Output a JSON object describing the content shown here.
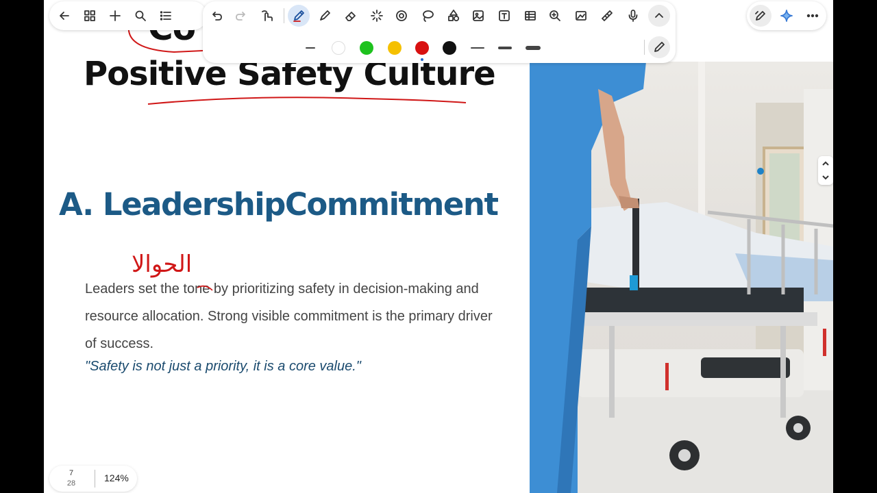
{
  "slide": {
    "title_top": "Co",
    "title": "Positive Safety Culture",
    "section_heading": "A. LeadershipCommitment",
    "body": "Leaders set the tone by prioritizing safety in decision-making and resource allocation. Strong visible commitment is the primary driver of success.",
    "quote": "\"Safety is not just a priority, it is a core value.\"",
    "handwritten_note": "الحوالا"
  },
  "navigation": {
    "page_current": "7",
    "page_total": "28",
    "zoom": "124%"
  },
  "nav_toolbar": {
    "icons": [
      "back-arrow-icon",
      "grid-icon",
      "plus-icon",
      "search-icon",
      "list-icon"
    ]
  },
  "main_toolbar": {
    "tools": [
      "undo-icon",
      "redo-icon",
      "lasso-hand-icon",
      "pen-icon",
      "highlighter-icon",
      "eraser-icon",
      "laser-pointer-icon",
      "shape-recognition-icon",
      "lasso-icon",
      "shapes-icon",
      "image-icon",
      "text-box-icon",
      "table-icon",
      "zoom-icon",
      "photo-icon",
      "ruler-icon",
      "microphone-icon",
      "collapse-icon"
    ],
    "active_tool": "pen",
    "colors": [
      "#ffffff",
      "#1ec21e",
      "#f5c000",
      "#d81010",
      "#111111"
    ],
    "selected_color": "#d81010",
    "stroke_widths": [
      "thin",
      "medium",
      "thick",
      "heavy"
    ]
  },
  "right_toolbar": {
    "icons": [
      "ai-pen-icon",
      "sparkle-icon",
      "more-icon"
    ]
  },
  "colors": {
    "accent_blue": "#1c5a86",
    "ink_red": "#d01717"
  }
}
